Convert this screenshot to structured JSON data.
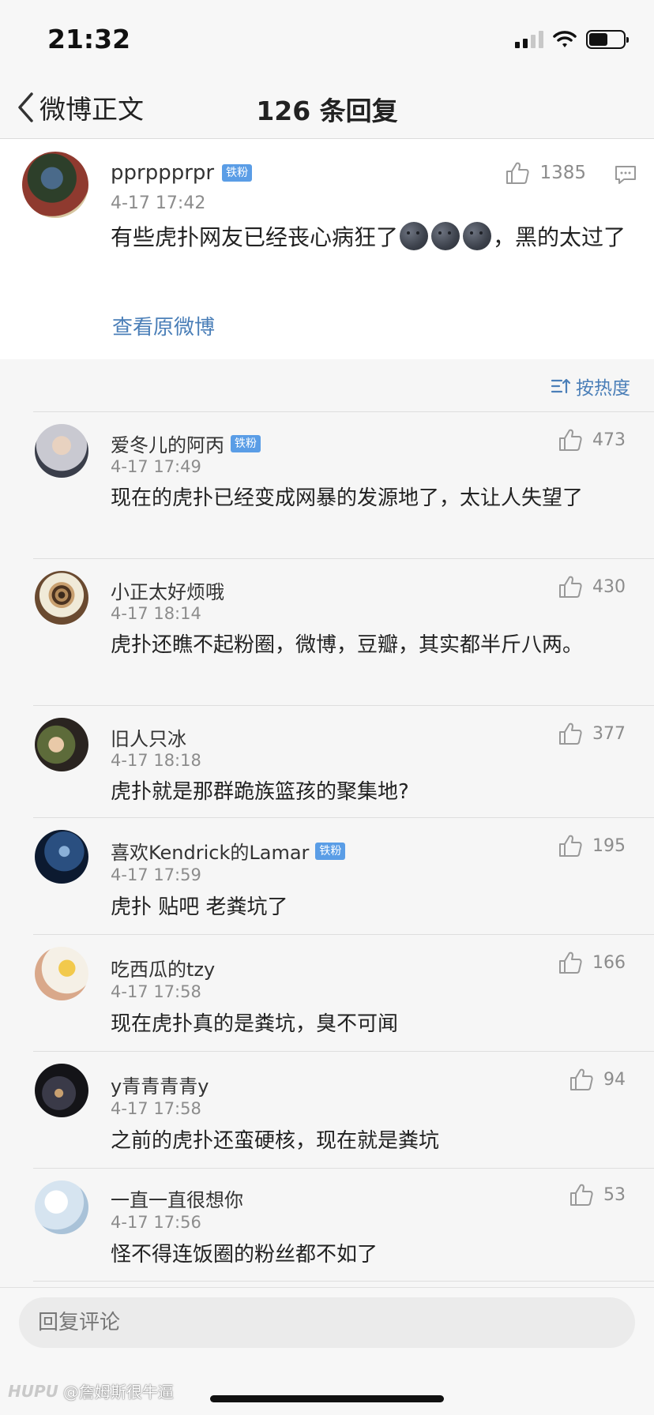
{
  "status_bar": {
    "time": "21:32"
  },
  "nav": {
    "back_label": "微博正文",
    "title": "126 条回复"
  },
  "original": {
    "username": "pprppprpr",
    "badge": "铁粉",
    "time": "4-17 17:42",
    "text_before": "有些虎扑网友已经丧心病狂了",
    "text_after": "，黑的太过了",
    "like_count": "1385",
    "link": "查看原微博"
  },
  "sort_label": "按热度",
  "comments": [
    {
      "username": "爱冬儿的阿丙",
      "badge": "铁粉",
      "time": "4-17 17:49",
      "text": "现在的虎扑已经变成网暴的发源地了，太让人失望了",
      "likes": "473"
    },
    {
      "username": "小正太好烦哦",
      "badge": "",
      "time": "4-17 18:14",
      "text": "虎扑还瞧不起粉圈，微博，豆瓣，其实都半斤八两。",
      "likes": "430"
    },
    {
      "username": "旧人只冰",
      "badge": "",
      "time": "4-17 18:18",
      "text": "虎扑就是那群跪族篮孩的聚集地?",
      "likes": "377"
    },
    {
      "username": "喜欢Kendrick的Lamar",
      "badge": "铁粉",
      "time": "4-17 17:59",
      "text": "虎扑 贴吧 老粪坑了",
      "likes": "195"
    },
    {
      "username": "吃西瓜的tzy",
      "badge": "",
      "time": "4-17 17:58",
      "text": "现在虎扑真的是粪坑，臭不可闻",
      "likes": "166"
    },
    {
      "username": "y青青青青y",
      "badge": "",
      "time": "4-17 17:58",
      "text": "之前的虎扑还蛮硬核，现在就是粪坑",
      "likes": "94"
    },
    {
      "username": "一直一直很想你",
      "badge": "",
      "time": "4-17 17:56",
      "text": "怪不得连饭圈的粉丝都不如了",
      "likes": "53"
    }
  ],
  "reply_placeholder": "回复评论",
  "watermark": {
    "brand": "HUPU",
    "handle": "@詹姆斯很牛逼"
  },
  "colors": {
    "link": "#4b7fb8",
    "badge": "#5a9de6",
    "secondary_text": "#8c8c8c"
  }
}
